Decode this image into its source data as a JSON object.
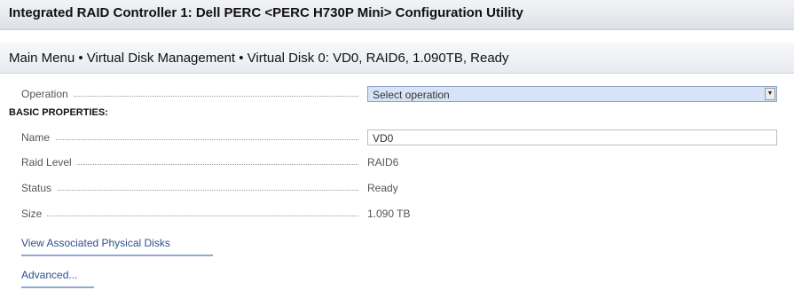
{
  "header": {
    "title": "Integrated RAID Controller 1: Dell PERC <PERC H730P Mini> Configuration Utility"
  },
  "breadcrumb": {
    "text": "Main Menu • Virtual Disk Management • Virtual Disk 0: VD0, RAID6, 1.090TB, Ready"
  },
  "form": {
    "operation": {
      "label": "Operation",
      "selected": "Select operation"
    },
    "basic_properties_heading": "BASIC PROPERTIES:",
    "name": {
      "label": "Name",
      "value": "VD0"
    },
    "raid_level": {
      "label": "Raid Level",
      "value": "RAID6"
    },
    "status": {
      "label": "Status",
      "value": "Ready"
    },
    "size": {
      "label": "Size",
      "value": "1.090 TB"
    }
  },
  "links": {
    "view_physical_disks": "View Associated Physical Disks",
    "advanced": "Advanced..."
  },
  "icons": {
    "dropdown": "chevron-down-icon"
  },
  "colors": {
    "select_background": "#d7e4f7",
    "link": "#2f4f8f",
    "link_underline": "#8fa8d4"
  }
}
